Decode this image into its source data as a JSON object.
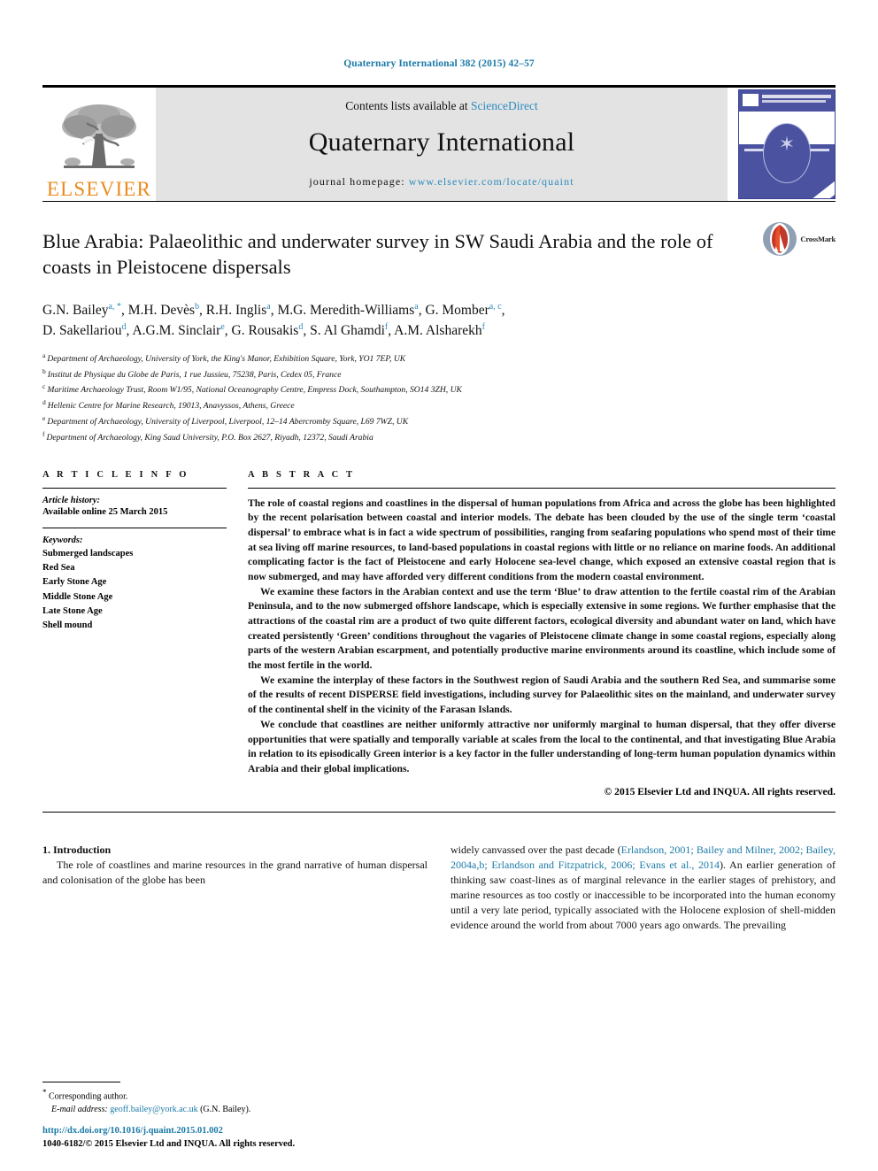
{
  "running_head": "Quaternary International 382 (2015) 42–57",
  "masthead": {
    "publisher_name": "ELSEVIER",
    "contents_prefix": "Contents lists available at",
    "contents_link": "ScienceDirect",
    "journal_title": "Quaternary International",
    "homepage_label": "journal homepage:",
    "homepage_url": "www.elsevier.com/locate/quaint",
    "cover_emblem": "✶"
  },
  "article": {
    "title": "Blue Arabia: Palaeolithic and underwater survey in SW Saudi Arabia and the role of coasts in Pleistocene dispersals",
    "crossmark_label": "CrossMark",
    "authors": [
      {
        "name": "G.N. Bailey",
        "marks": "a, *"
      },
      {
        "name": "M.H. Devès",
        "marks": "b"
      },
      {
        "name": "R.H. Inglis",
        "marks": "a"
      },
      {
        "name": "M.G. Meredith-Williams",
        "marks": "a"
      },
      {
        "name": "G. Momber",
        "marks": "a, c"
      },
      {
        "name": "D. Sakellariou",
        "marks": "d"
      },
      {
        "name": "A.G.M. Sinclair",
        "marks": "e"
      },
      {
        "name": "G. Rousakis",
        "marks": "d"
      },
      {
        "name": "S. Al Ghamdi",
        "marks": "f"
      },
      {
        "name": "A.M. Alsharekh",
        "marks": "f"
      }
    ],
    "affiliations": [
      {
        "mark": "a",
        "text": "Department of Archaeology, University of York, the King's Manor, Exhibition Square, York, YO1 7EP, UK"
      },
      {
        "mark": "b",
        "text": "Institut de Physique du Globe de Paris, 1 rue Jussieu, 75238, Paris, Cedex 05, France"
      },
      {
        "mark": "c",
        "text": "Maritime Archaeology Trust, Room W1/95, National Oceanography Centre, Empress Dock, Southampton, SO14 3ZH, UK"
      },
      {
        "mark": "d",
        "text": "Hellenic Centre for Marine Research, 19013, Anavyssos, Athens, Greece"
      },
      {
        "mark": "e",
        "text": "Department of Archaeology, University of Liverpool, Liverpool, 12–14 Abercromby Square, L69 7WZ, UK"
      },
      {
        "mark": "f",
        "text": "Department of Archaeology, King Saud University, P.O. Box 2627, Riyadh, 12372, Saudi Arabia"
      }
    ]
  },
  "article_info": {
    "heading": "A R T I C L E  I N F O",
    "history_label": "Article history:",
    "history_value": "Available online 25 March 2015",
    "keywords_label": "Keywords:",
    "keywords": [
      "Submerged landscapes",
      "Red Sea",
      "Early Stone Age",
      "Middle Stone Age",
      "Late Stone Age",
      "Shell mound"
    ]
  },
  "abstract": {
    "heading": "A B S T R A C T",
    "paragraphs": [
      "The role of coastal regions and coastlines in the dispersal of human populations from Africa and across the globe has been highlighted by the recent polarisation between coastal and interior models. The debate has been clouded by the use of the single term ‘coastal dispersal’ to embrace what is in fact a wide spectrum of possibilities, ranging from seafaring populations who spend most of their time at sea living off marine resources, to land-based populations in coastal regions with little or no reliance on marine foods. An additional complicating factor is the fact of Pleistocene and early Holocene sea-level change, which exposed an extensive coastal region that is now submerged, and may have afforded very different conditions from the modern coastal environment.",
      "We examine these factors in the Arabian context and use the term ‘Blue’ to draw attention to the fertile coastal rim of the Arabian Peninsula, and to the now submerged offshore landscape, which is especially extensive in some regions. We further emphasise that the attractions of the coastal rim are a product of two quite different factors, ecological diversity and abundant water on land, which have created persistently ‘Green’ conditions throughout the vagaries of Pleistocene climate change in some coastal regions, especially along parts of the western Arabian escarpment, and potentially productive marine environments around its coastline, which include some of the most fertile in the world.",
      "We examine the interplay of these factors in the Southwest region of Saudi Arabia and the southern Red Sea, and summarise some of the results of recent DISPERSE field investigations, including survey for Palaeolithic sites on the mainland, and underwater survey of the continental shelf in the vicinity of the Farasan Islands.",
      "We conclude that coastlines are neither uniformly attractive nor uniformly marginal to human dispersal, that they offer diverse opportunities that were spatially and temporally variable at scales from the local to the continental, and that investigating Blue Arabia in relation to its episodically Green interior is a key factor in the fuller understanding of long-term human population dynamics within Arabia and their global implications."
    ],
    "copyright": "© 2015 Elsevier Ltd and INQUA. All rights reserved."
  },
  "body": {
    "section_number_title": "1. Introduction",
    "left_paragraph": "The role of coastlines and marine resources in the grand narrative of human dispersal and colonisation of the globe has been",
    "right_paragraph_pre": "widely canvassed over the past decade (",
    "right_citations": "Erlandson, 2001; Bailey and Milner, 2002; Bailey, 2004a,b; Erlandson and Fitzpatrick, 2006; Evans et al., 2014",
    "right_paragraph_post": "). An earlier generation of thinking saw coast-lines as of marginal relevance in the earlier stages of prehistory, and marine resources as too costly or inaccessible to be incorporated into the human economy until a very late period, typically associated with the Holocene explosion of shell-midden evidence around the world from about 7000 years ago onwards. The prevailing"
  },
  "footer": {
    "corresponding_mark": "*",
    "corresponding_label": "Corresponding author.",
    "email_label": "E-mail address:",
    "email": "geoff.bailey@york.ac.uk",
    "email_owner": "(G.N. Bailey).",
    "doi": "http://dx.doi.org/10.1016/j.quaint.2015.01.002",
    "issn_line": "1040-6182/© 2015 Elsevier Ltd and INQUA. All rights reserved."
  },
  "colors": {
    "link_blue": "#1b7aa8",
    "elsevier_orange": "#ea8b1f",
    "cover_blue": "#4b53a0"
  }
}
